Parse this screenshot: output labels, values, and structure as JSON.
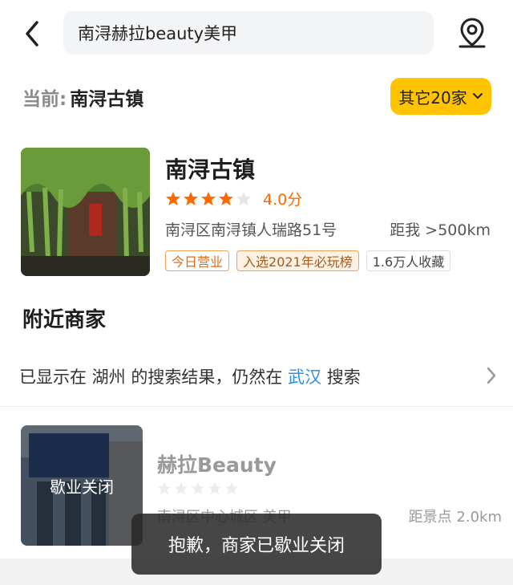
{
  "search": {
    "query": "南浔赫拉beauty美甲"
  },
  "icons": {
    "back": "chevron-left-icon",
    "location": "location-pin-icon",
    "dropdown": "chevron-down-icon",
    "arrow": "chevron-right-icon",
    "star": "star-icon"
  },
  "current": {
    "label": "当前:",
    "value": "南浔古镇",
    "others_button": "其它20家"
  },
  "shop": {
    "name": "南浔古镇",
    "rating": 4.0,
    "rating_text": "4.0分",
    "address": "南浔区南浔镇人瑞路51号",
    "distance": "距我 >500km",
    "tags": [
      "今日营业",
      "入选2021年必玩榜",
      "1.6万人收藏"
    ]
  },
  "nearby": {
    "title": "附近商家",
    "notice_prefix": "已显示在 湖州 的搜索结果，仍然在",
    "notice_link": "武汉",
    "notice_suffix": "搜索"
  },
  "closed_shop": {
    "image_overlay": "歇业关闭",
    "name": "赫拉Beauty",
    "rating": 0,
    "address": "南浔区中心城区 美甲",
    "distance": "距景点 2.0km"
  },
  "toast": {
    "message": "抱歉，商家已歇业关闭"
  },
  "colors": {
    "accent": "#ffc300",
    "star": "#ff6a00",
    "link": "#2f8fd8"
  }
}
